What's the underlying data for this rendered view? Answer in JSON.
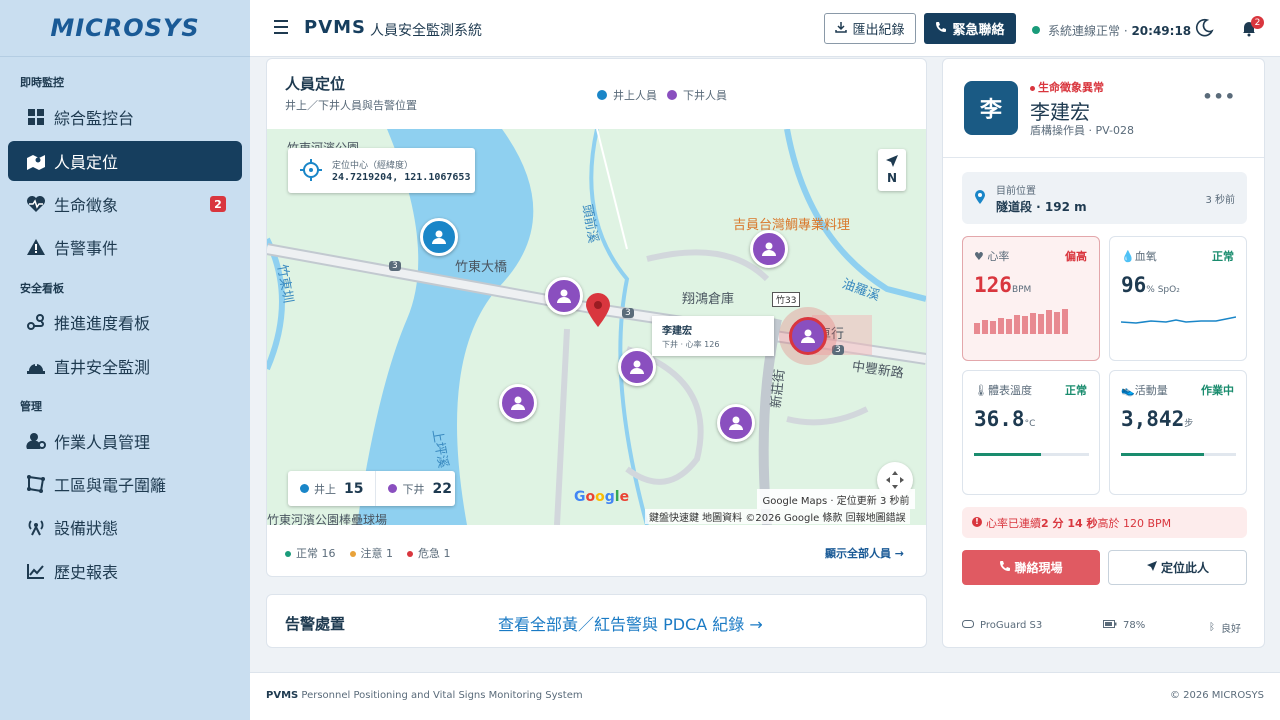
{
  "sidebar": {
    "logo": "MICROSYS",
    "sections": {
      "realtime": "即時監控",
      "safety": "安全看板",
      "manage": "管理"
    },
    "items": [
      {
        "label": "綜合監控台",
        "icon": "dashboard-icon"
      },
      {
        "label": "人員定位",
        "icon": "map-user-icon",
        "active": true
      },
      {
        "label": "生命徵象",
        "icon": "heartbeat-icon",
        "badge": "2"
      },
      {
        "label": "告警事件",
        "icon": "warning-icon"
      },
      {
        "label": "推進進度看板",
        "icon": "progress-icon"
      },
      {
        "label": "直井安全監測",
        "icon": "shaft-icon"
      },
      {
        "label": "作業人員管理",
        "icon": "user-gear-icon"
      },
      {
        "label": "工區與電子圍籬",
        "icon": "fence-icon"
      },
      {
        "label": "設備狀態",
        "icon": "antenna-icon"
      },
      {
        "label": "歷史報表",
        "icon": "chart-line-icon"
      }
    ]
  },
  "topbar": {
    "brand": "PVMS",
    "subtitle": "人員安全監測系統",
    "export_label": "匯出紀錄",
    "emergency_label": "緊急聯絡",
    "connection_text": "系統連線正常 · ",
    "time": "20:49:18",
    "notify_count": "2"
  },
  "map_panel": {
    "title": "人員定位",
    "subtitle": "井上／下井人員與告警位置",
    "legend_up": "井上人員",
    "legend_down": "下井人員",
    "coord_label": "定位中心（經緯度）",
    "coord_value": "24.7219204, 121.1067653",
    "compass_label": "N",
    "tooltip_name": "李建宏",
    "tooltip_sub": "下井 · 心率 126",
    "count_up_label": "井上",
    "count_up": "15",
    "count_down_label": "下井",
    "count_down": "22",
    "google_text": "Google",
    "attr_text": "Google Maps · 定位更新 3 秒前",
    "copyright_text": "鍵盤快速鍵   地圖資料 ©2026 Google   條款   回報地圖錯誤",
    "map_labels": {
      "bridge": "竹東大橋",
      "restaurant": "吉員台灣鯛專業料理",
      "warehouse": "翔鴻倉庫",
      "river": "油羅溪",
      "road": "中豐新路",
      "road2": "新莊街",
      "road3": "竹東圳",
      "park": "竹東河濱公園棒壘球場",
      "route_3": "3",
      "route_33": "竹33",
      "shop": "機車行",
      "road4": "頭前溪",
      "road5": "上坪溪",
      "park2": "竹東河濱公園"
    },
    "status_normal": "正常 16",
    "status_warn": "注意 1",
    "status_danger": "危急 1",
    "show_all": "顯示全部人員 →"
  },
  "alert_panel": {
    "title": "告警處置",
    "link": "查看全部黃／紅告警與 PDCA 紀錄 →"
  },
  "person": {
    "avatar": "李",
    "alert": "生命徵象異常",
    "name": "李建宏",
    "role": "盾構操作員 · PV-028",
    "more": "•••",
    "location_label": "目前位置",
    "location_value": "隧道段 · 192 m",
    "location_time": "3 秒前",
    "heart_label": "心率",
    "heart_status": "偏高",
    "heart_value": "126",
    "heart_unit": "BPM",
    "heart_history": [
      40,
      55,
      50,
      62,
      58,
      72,
      70,
      80,
      75,
      90,
      82,
      95
    ],
    "spo2_label": "血氧",
    "spo2_status": "正常",
    "spo2_value": "96",
    "spo2_unit": "% SpO₂",
    "temp_label": "體表溫度",
    "temp_status": "正常",
    "temp_value": "36.8",
    "temp_unit": "°C",
    "temp_level": 0.58,
    "activity_label": "活動量",
    "activity_status": "作業中",
    "activity_value": "3,842",
    "activity_unit": "步",
    "activity_level": 0.72,
    "hr_alert_prefix": "心率已連續 ",
    "hr_alert_dur": "2 分 14 秒",
    "hr_alert_suffix": " 高於 120 BPM",
    "call_label": "聯絡現場",
    "locate_label": "定位此人",
    "device": "ProGuard S3",
    "battery": "78%",
    "signal": "良好"
  },
  "footer": {
    "brand": "PVMS",
    "desc": " Personnel Positioning and Vital Signs Monitoring System",
    "copyright": "© 2026 MICROSYS"
  },
  "colors": {
    "primary": "#163e5e",
    "up_worker": "#1a86c8",
    "down_worker": "#8a4fbf",
    "danger": "#d9363e",
    "ok": "#1a8c6e",
    "warn": "#e8a23a"
  }
}
